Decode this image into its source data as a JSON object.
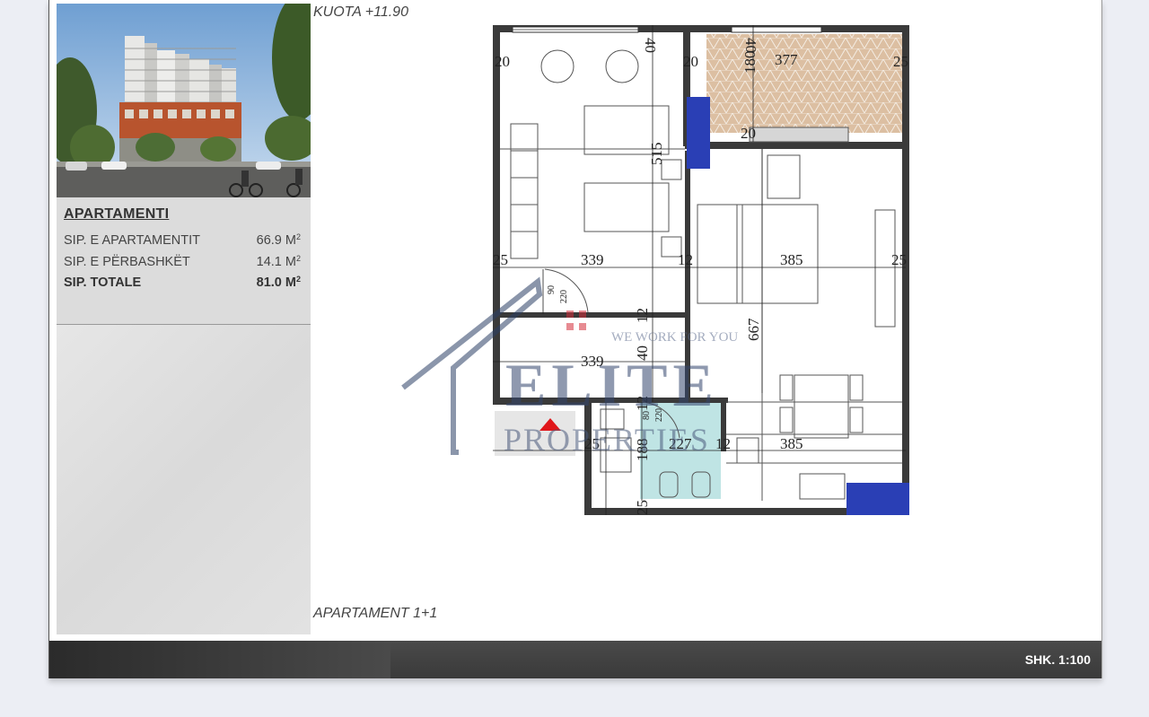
{
  "header": {
    "level_label": "KUOTA +11.90"
  },
  "info": {
    "title": "APARTAMENTI",
    "rows": [
      {
        "label": "SIP. E APARTAMENTIT",
        "value": "66.9 M",
        "unit_sup": "2"
      },
      {
        "label": "SIP. E PËRBASHKËT",
        "value": "14.1 M",
        "unit_sup": "2"
      },
      {
        "label": "SIP. TOTALE",
        "value": "81.0 M",
        "unit_sup": "2"
      }
    ]
  },
  "apartment_label": "APARTAMENT  1+1",
  "footer": {
    "scale": "SHK. 1:100"
  },
  "plan": {
    "dims": {
      "d40a": "40",
      "d40b": "40",
      "d20a": "20",
      "d20b": "20",
      "d377": "377",
      "d25a": "25",
      "d180": "180",
      "d20c": "20",
      "d515": "515",
      "d25b": "25",
      "d339a": "339",
      "d12a": "12",
      "d385a": "385",
      "d25c": "25",
      "d90": "90",
      "d220a": "220",
      "d12b": "12",
      "d667": "667",
      "d339b": "339",
      "d40c": "40",
      "d12c": "12",
      "d80": "80",
      "d220b": "220",
      "d25d": "25",
      "d188": "188",
      "d227": "227",
      "d12d": "12",
      "d385b": "385",
      "d25e": "25"
    }
  },
  "watermark": {
    "tagline": "WE WORK FOR YOU",
    "brand": "ELITE",
    "sub": "PROPERTIES"
  },
  "colors": {
    "wall": "#3c3c3c",
    "window_blue": "#2a3fb5",
    "balcony": "#d8b89a",
    "bath_tile": "#b9e3e3",
    "footer": "#3f3f3f"
  }
}
